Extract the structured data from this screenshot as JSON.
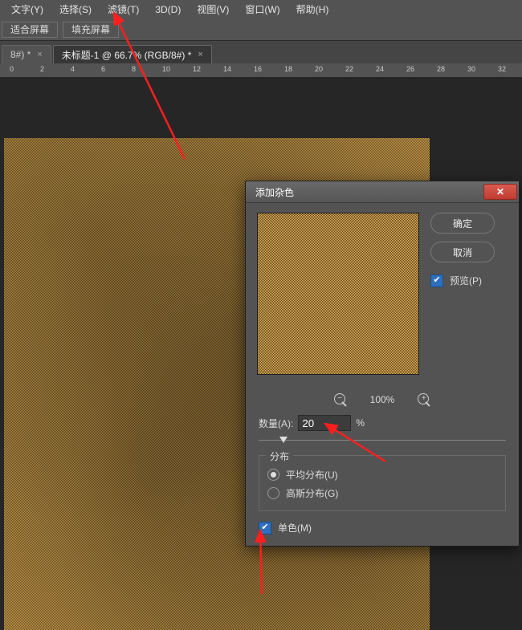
{
  "menu": {
    "items": [
      "文字(Y)",
      "选择(S)",
      "滤镜(T)",
      "3D(D)",
      "视图(V)",
      "窗口(W)",
      "帮助(H)"
    ]
  },
  "options": {
    "fit": "适合屏幕",
    "fill": "填充屏幕"
  },
  "tabs": {
    "t0": "8#) *",
    "t1": "未标题-1 @ 66.7% (RGB/8#) *"
  },
  "ruler": {
    "ticks": [
      "0",
      "2",
      "4",
      "6",
      "8",
      "10",
      "12",
      "14",
      "16",
      "18",
      "20",
      "22",
      "24",
      "26",
      "28",
      "30",
      "32"
    ]
  },
  "dialog": {
    "title": "添加杂色",
    "ok": "确定",
    "cancel": "取消",
    "preview_label": "预览(P)",
    "zoom_pct": "100%",
    "amount_label": "数量(A):",
    "amount_value": "20",
    "amount_unit": "%",
    "dist_label": "分布",
    "dist_uniform": "平均分布(U)",
    "dist_gaussian": "高斯分布(G)",
    "mono_label": "单色(M)"
  },
  "chart_data": null
}
